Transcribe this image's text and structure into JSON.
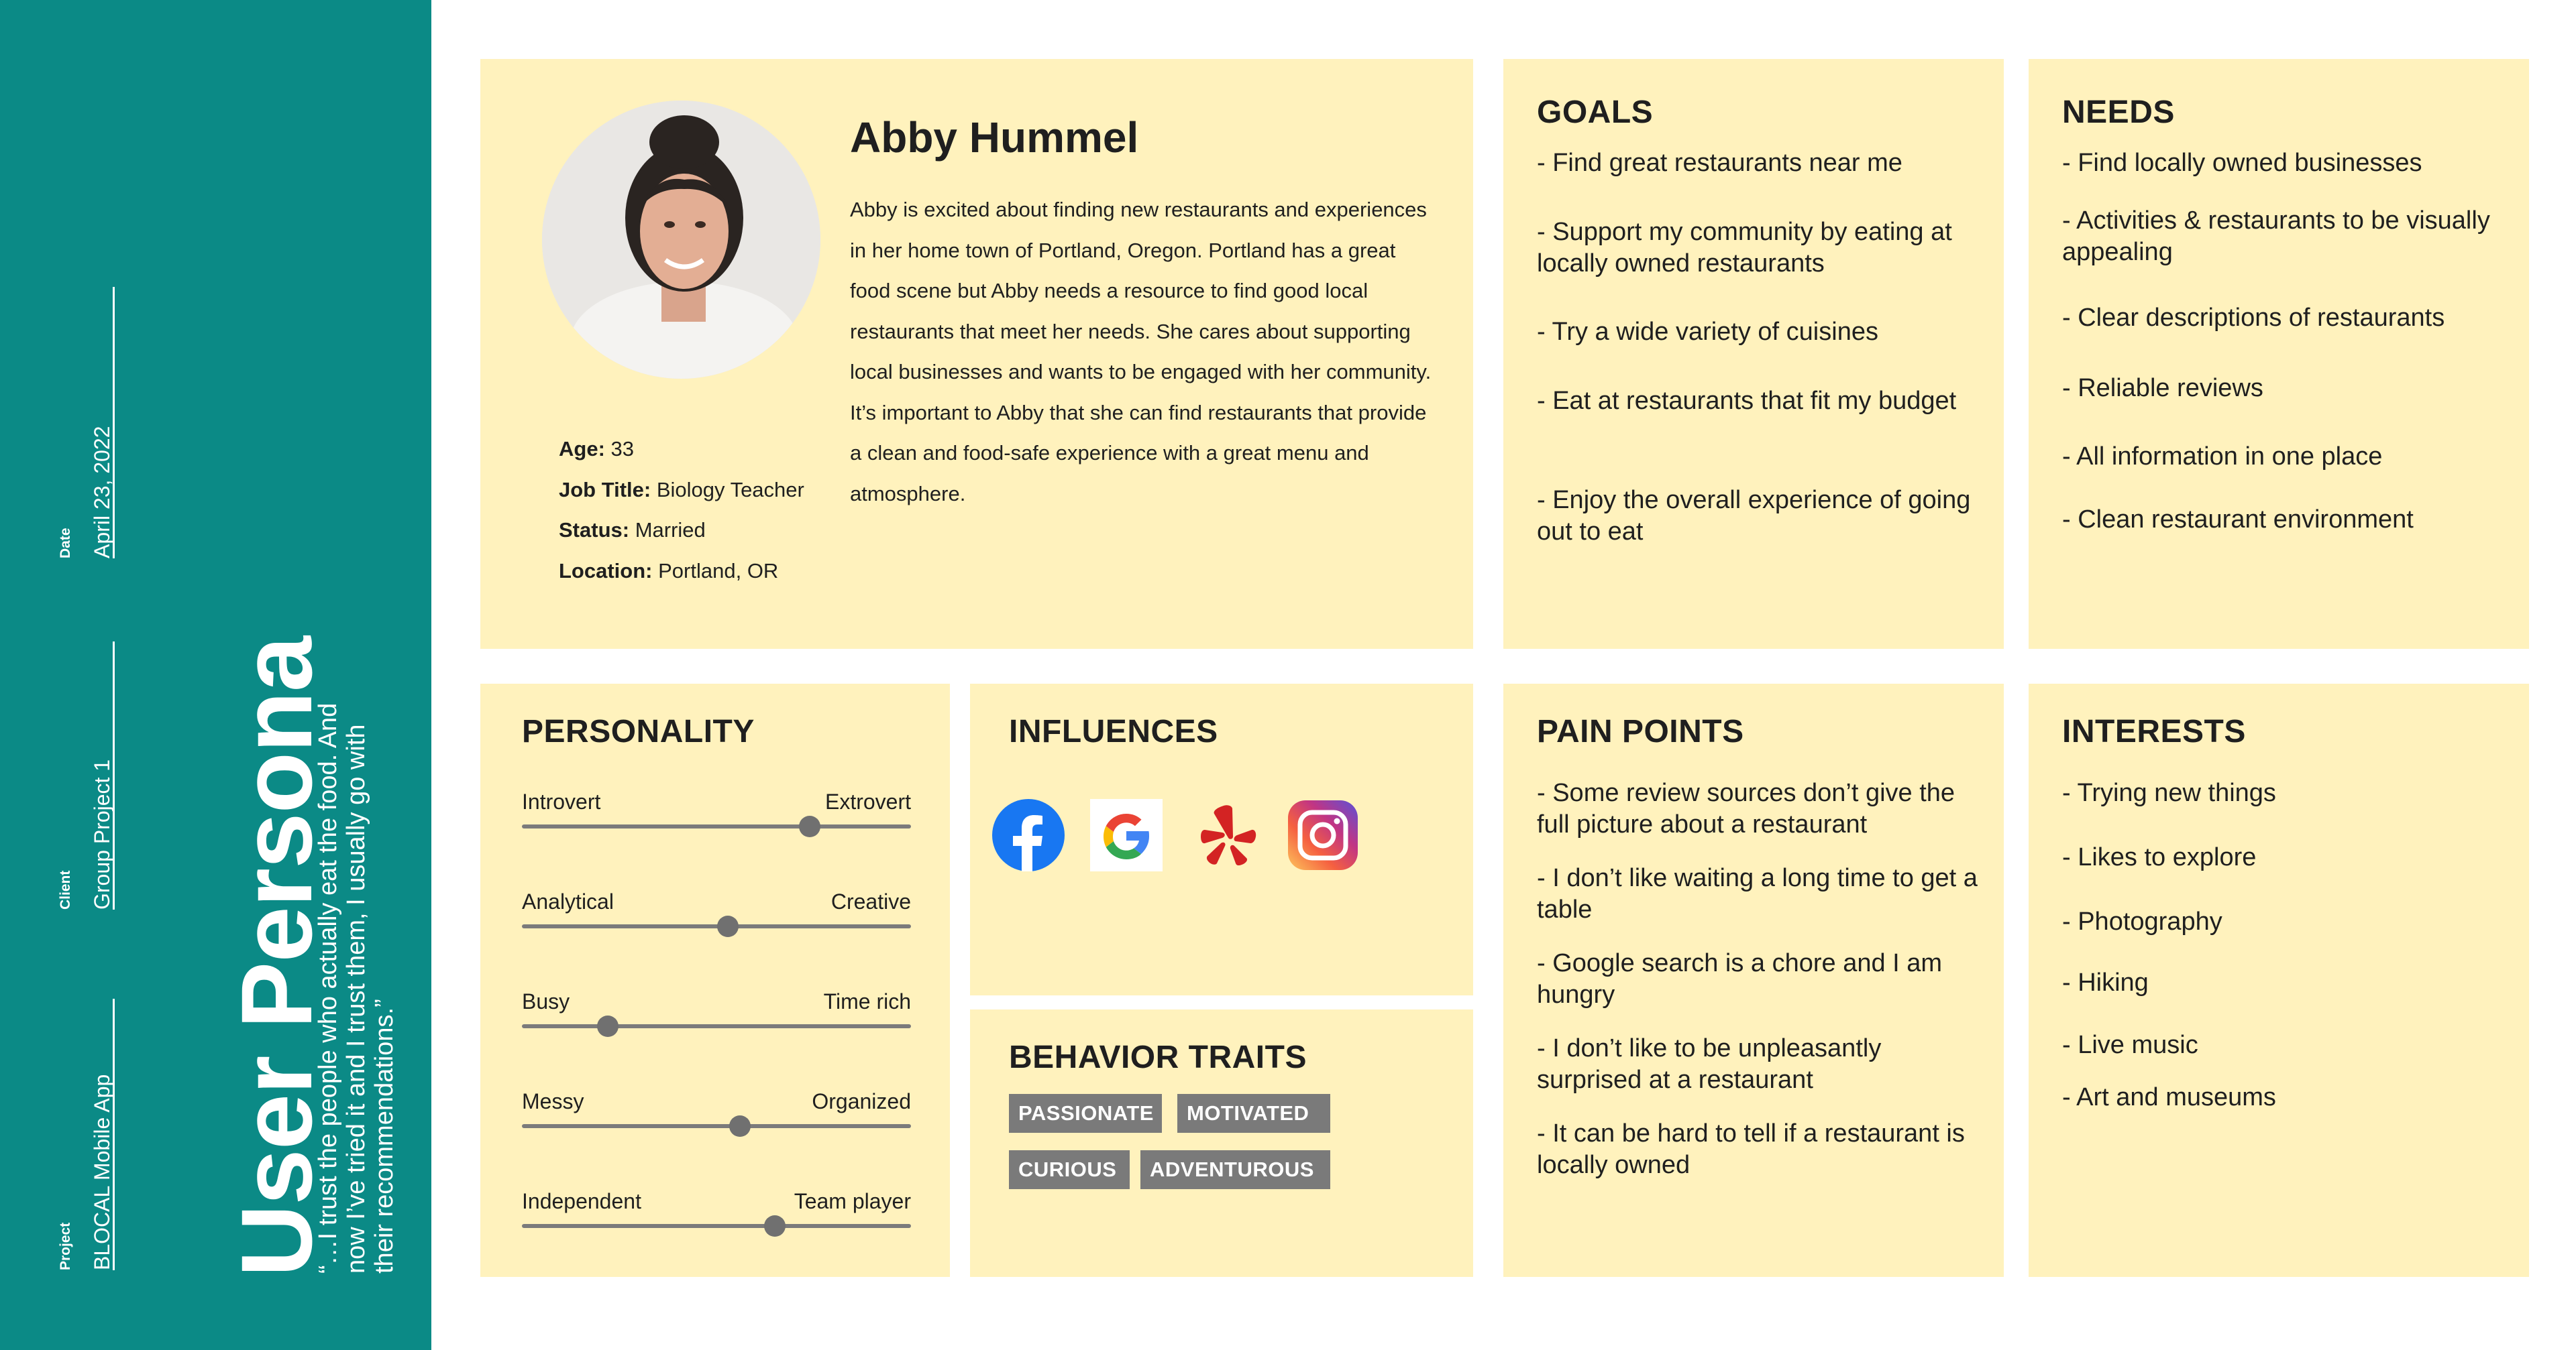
{
  "sidebar": {
    "title": "User Persona",
    "quote": "“…I trust the people who actually eat the food. And now I’ve tried it and I trust them, I usually go with their recommendations.”",
    "meta": [
      {
        "label": "Project",
        "value": "BLOCAL Mobile App"
      },
      {
        "label": "Client",
        "value": "Group Project 1"
      },
      {
        "label": "Date",
        "value": "April 23, 2022"
      }
    ]
  },
  "profile": {
    "name": "Abby Hummel",
    "bio": "Abby is excited about finding new restaurants and experiences in her home town of Portland, Oregon. Portland has a great food scene but Abby needs a resource to find good local restaurants that meet her needs. She cares about supporting local businesses and wants to be engaged with her community. It’s important to Abby that she can find restaurants that provide a clean and food-safe experience with a great menu and atmosphere.",
    "facts": [
      {
        "label": "Age:",
        "value": "33"
      },
      {
        "label": "Job Title:",
        "value": "Biology Teacher"
      },
      {
        "label": "Status:",
        "value": "Married"
      },
      {
        "label": "Location:",
        "value": "Portland, OR"
      }
    ]
  },
  "goals": {
    "title": "GOALS",
    "items": [
      "- Find great restaurants near me",
      "- Support my community by eating at locally owned restaurants",
      "- Try a wide variety of cuisines",
      "- Eat at restaurants that fit my budget",
      "- Enjoy the overall experience of going out to eat"
    ]
  },
  "needs": {
    "title": "NEEDS",
    "items": [
      "- Find locally owned businesses",
      "- Activities & restaurants to be visually appealing",
      "- Clear descriptions of restaurants",
      "- Reliable reviews",
      "- All information in one place",
      "- Clean restaurant environment"
    ]
  },
  "personality": {
    "title": "PERSONALITY",
    "sliders": [
      {
        "left": "Introvert",
        "right": "Extrovert",
        "value": 0.74
      },
      {
        "left": "Analytical",
        "right": "Creative",
        "value": 0.53
      },
      {
        "left": "Busy",
        "right": "Time rich",
        "value": 0.22
      },
      {
        "left": "Messy",
        "right": "Organized",
        "value": 0.56
      },
      {
        "left": "Independent",
        "right": "Team player",
        "value": 0.65
      }
    ]
  },
  "influences": {
    "title": "INFLUENCES",
    "icons": [
      "facebook-icon",
      "google-icon",
      "yelp-icon",
      "instagram-icon"
    ],
    "colors": {
      "facebook": "#1877f2",
      "yelp": "#d32323"
    }
  },
  "behavior": {
    "title": "BEHAVIOR TRAITS",
    "tags": [
      "PASSIONATE",
      "MOTIVATED",
      "CURIOUS",
      "ADVENTUROUS"
    ]
  },
  "pain_points": {
    "title": "PAIN POINTS",
    "items": [
      "- Some review sources don’t give the full picture about a restaurant",
      "- I don’t like waiting a long time to get a table",
      "- Google search is a chore and I am hungry",
      "- I don’t like to be unpleasantly surprised at a restaurant",
      "- It can be hard to tell if a restaurant is locally owned"
    ]
  },
  "interests": {
    "title": "INTERESTS",
    "items": [
      "- Trying new things",
      "- Likes to explore",
      "- Photography",
      "- Hiking",
      "- Live music",
      "- Art and museums"
    ]
  },
  "colors": {
    "sidebar": "#0b8a86",
    "card": "#fff2bd",
    "tag": "#7a7a7a"
  }
}
